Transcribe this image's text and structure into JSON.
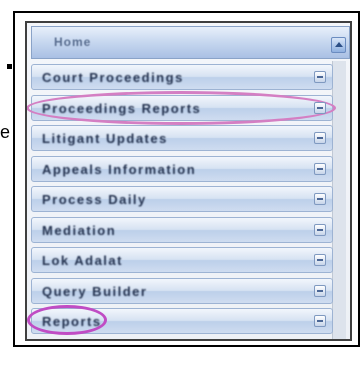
{
  "menu": {
    "header_label": "Home",
    "items": [
      {
        "label": "Court Proceedings"
      },
      {
        "label": "Proceedings Reports"
      },
      {
        "label": "Litigant Updates"
      },
      {
        "label": "Appeals Information"
      },
      {
        "label": "Process Daily"
      },
      {
        "label": "Mediation"
      },
      {
        "label": "Lok Adalat"
      },
      {
        "label": "Query Builder"
      },
      {
        "label": "Reports"
      }
    ]
  },
  "page": {
    "side_letter": "e"
  },
  "colors": {
    "highlight_oval": "#d47fc3",
    "highlight_small": "#c04cc4",
    "item_text": "#24324f"
  },
  "icons": {
    "expand": "expand-icon",
    "scroll_up": "scroll-up-arrow-icon"
  }
}
